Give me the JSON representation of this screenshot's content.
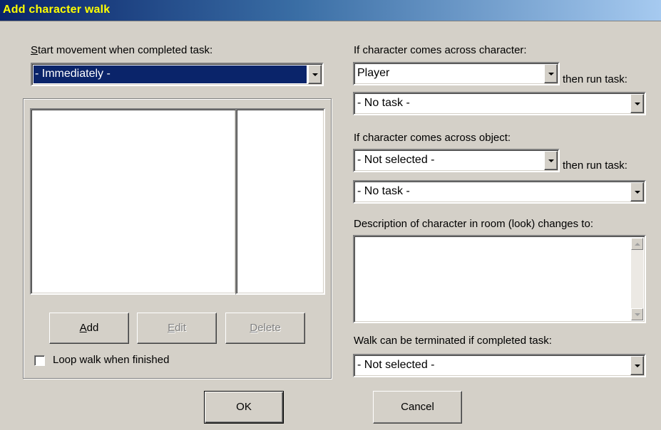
{
  "window": {
    "title": "Add character walk"
  },
  "left": {
    "start_label_mnemonic": "S",
    "start_label_rest": "tart movement when completed task:",
    "start_value": "- Immediately -",
    "buttons": {
      "add_mnemonic": "A",
      "add_rest": "dd",
      "edit_mnemonic": "E",
      "edit_rest": "dit",
      "delete_mnemonic": "D",
      "delete_rest": "elete"
    },
    "loop_label": "Loop walk when finished",
    "loop_checked": false
  },
  "right": {
    "char_label": "If character comes across character:",
    "char_value": "Player",
    "then_run_task_1": "then run task:",
    "char_task_value": "- No task -",
    "obj_label": "If character comes across object:",
    "obj_value": "- Not selected -",
    "then_run_task_2": "then run task:",
    "obj_task_value": "- No task -",
    "desc_label": "Description of character in room (look) changes to:",
    "terminate_label": "Walk can be terminated if completed task:",
    "terminate_value": "- Not selected -"
  },
  "footer": {
    "ok_label": "OK",
    "cancel_label": "Cancel"
  },
  "colors": {
    "titlebar_start": "#0a246a",
    "titlebar_end": "#a6caf0",
    "title_text": "#ffff00",
    "dialog_bg": "#d4d0c8",
    "selection": "#0a246a"
  },
  "icons": [
    "dropdown-arrow-icon",
    "scroll-up-icon",
    "scroll-down-icon",
    "checkbox-icon"
  ]
}
